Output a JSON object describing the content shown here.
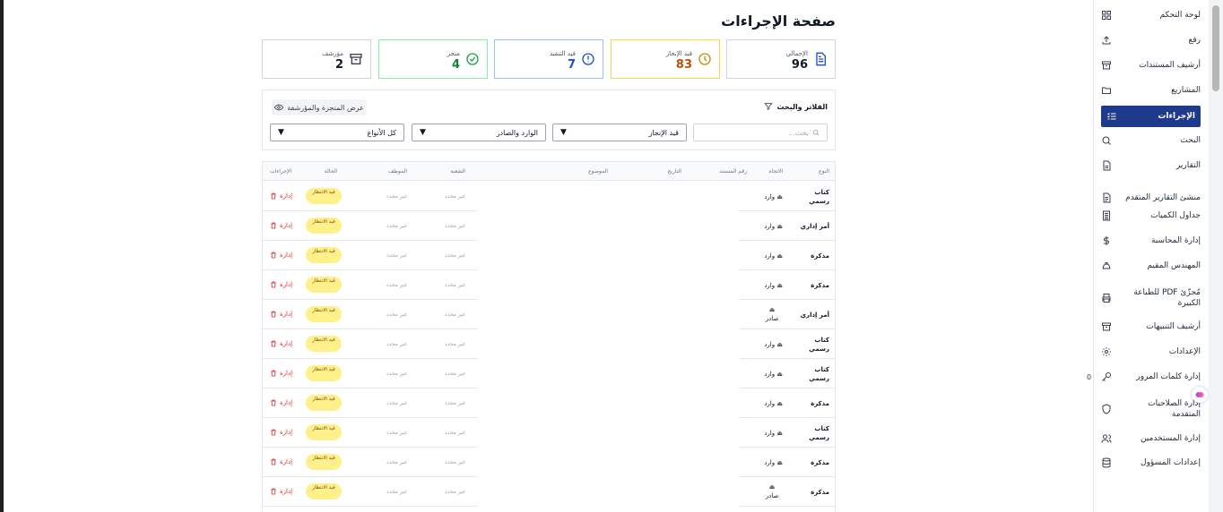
{
  "page": {
    "title": "صفحة الإجراءات"
  },
  "stats": [
    {
      "label": "الإجمالي",
      "value": "96",
      "color": "#111827",
      "border": "#d1d5db",
      "icon": "document-icon",
      "icon_color": "#1d4ed8"
    },
    {
      "label": "قيد الإنجاز",
      "value": "83",
      "color": "#b45309",
      "border": "#fcd34d",
      "icon": "clock-icon",
      "icon_color": "#ca8a04"
    },
    {
      "label": "قيد التنفيذ",
      "value": "7",
      "color": "#1d4ed8",
      "border": "#93c5fd",
      "icon": "info-icon",
      "icon_color": "#1d4ed8"
    },
    {
      "label": "منجز",
      "value": "4",
      "color": "#15803d",
      "border": "#86efac",
      "icon": "check-circle-icon",
      "icon_color": "#16a34a"
    },
    {
      "label": "مؤرشف",
      "value": "2",
      "color": "#111827",
      "border": "#d1d5db",
      "icon": "archive-icon",
      "icon_color": "#374151"
    }
  ],
  "filters": {
    "title": "الفلاتر والبحث",
    "toggle_label": "عرض المنجزة والمؤرشفة",
    "search_placeholder": "بحث...",
    "status_value": "قيد الإنجاز",
    "direction_value": "الوارد والصادر",
    "type_value": "كل الأنواع"
  },
  "table": {
    "headers": {
      "type": "النوع",
      "direction": "الاتجاه",
      "doc_number": "رقم المستند",
      "date": "التاريخ",
      "subject": "الموضوع",
      "division": "الشعبة",
      "employee": "الموظف",
      "status": "الحالة",
      "actions": "الإجراءات"
    },
    "rows": [
      {
        "type": "كتاب رسمي",
        "direction": "وارد",
        "division": "غير محدد",
        "employee": "غير محدد",
        "status": "قيد الانتظار",
        "action": "إدارة"
      },
      {
        "type": "أمر إداري",
        "direction": "وارد",
        "division": "غير محدد",
        "employee": "غير محدد",
        "status": "قيد الانتظار",
        "action": "إدارة"
      },
      {
        "type": "مذكرة",
        "direction": "وارد",
        "division": "غير محدد",
        "employee": "غير محدد",
        "status": "قيد الانتظار",
        "action": "إدارة"
      },
      {
        "type": "مذكرة",
        "direction": "وارد",
        "division": "غير محدد",
        "employee": "غير محدد",
        "status": "قيد الانتظار",
        "action": "إدارة"
      },
      {
        "type": "أمر إداري",
        "direction": "صادر",
        "division": "غير محدد",
        "employee": "غير محدد",
        "status": "قيد الانتظار",
        "action": "إدارة"
      },
      {
        "type": "كتاب رسمي",
        "direction": "وارد",
        "division": "غير محدد",
        "employee": "غير محدد",
        "status": "قيد الانتظار",
        "action": "إدارة"
      },
      {
        "type": "كتاب رسمي",
        "direction": "وارد",
        "division": "غير محدد",
        "employee": "غير محدد",
        "status": "قيد الانتظار",
        "action": "إدارة"
      },
      {
        "type": "مذكرة",
        "direction": "وارد",
        "division": "غير محدد",
        "employee": "غير محدد",
        "status": "قيد الانتظار",
        "action": "إدارة"
      },
      {
        "type": "كتاب رسمي",
        "direction": "وارد",
        "division": "غير محدد",
        "employee": "غير محدد",
        "status": "قيد الانتظار",
        "action": "إدارة"
      },
      {
        "type": "مذكرة",
        "direction": "وارد",
        "division": "غير محدد",
        "employee": "غير محدد",
        "status": "قيد الانتظار",
        "action": "إدارة"
      },
      {
        "type": "مذكرة",
        "direction": "صادر",
        "division": "غير محدد",
        "employee": "غير محدد",
        "status": "قيد الانتظار",
        "action": "إدارة"
      }
    ]
  },
  "sidebar": {
    "items": [
      {
        "label": "لوحة التحكم",
        "icon": "dashboard-icon"
      },
      {
        "label": "رفع",
        "icon": "upload-icon"
      },
      {
        "label": "أرشيف المستندات",
        "icon": "archive-icon"
      },
      {
        "label": "المشاريع",
        "icon": "folder-icon"
      },
      {
        "label": "الإجراءات",
        "icon": "list-check-icon",
        "active": true
      },
      {
        "label": "البحث",
        "icon": "search-icon"
      },
      {
        "label": "التقارير",
        "icon": "report-icon"
      },
      {
        "label": "منشئ التقارير المتقدم",
        "icon": "report-builder-icon"
      },
      {
        "label": "جداول الكميات",
        "icon": "spreadsheet-icon"
      },
      {
        "label": "إدارة المحاسبة",
        "icon": "dollar-icon"
      },
      {
        "label": "المهندس المقيم",
        "icon": "hardhat-icon"
      },
      {
        "label": "مُجزّئ PDF للطباعة الكبيرة",
        "icon": "printer-icon"
      },
      {
        "label": "أرشيف التنبيهات",
        "icon": "archive-icon"
      },
      {
        "label": "الإعدادات",
        "icon": "gear-icon"
      },
      {
        "label": "إدارة كلمات المرور",
        "icon": "key-icon",
        "count": "0"
      },
      {
        "label": "إدارة الصلاحيات المتقدمة",
        "icon": "shield-icon"
      },
      {
        "label": "إدارة المستخدمين",
        "icon": "users-icon"
      },
      {
        "label": "إعدادات المسؤول",
        "icon": "database-icon"
      }
    ]
  }
}
